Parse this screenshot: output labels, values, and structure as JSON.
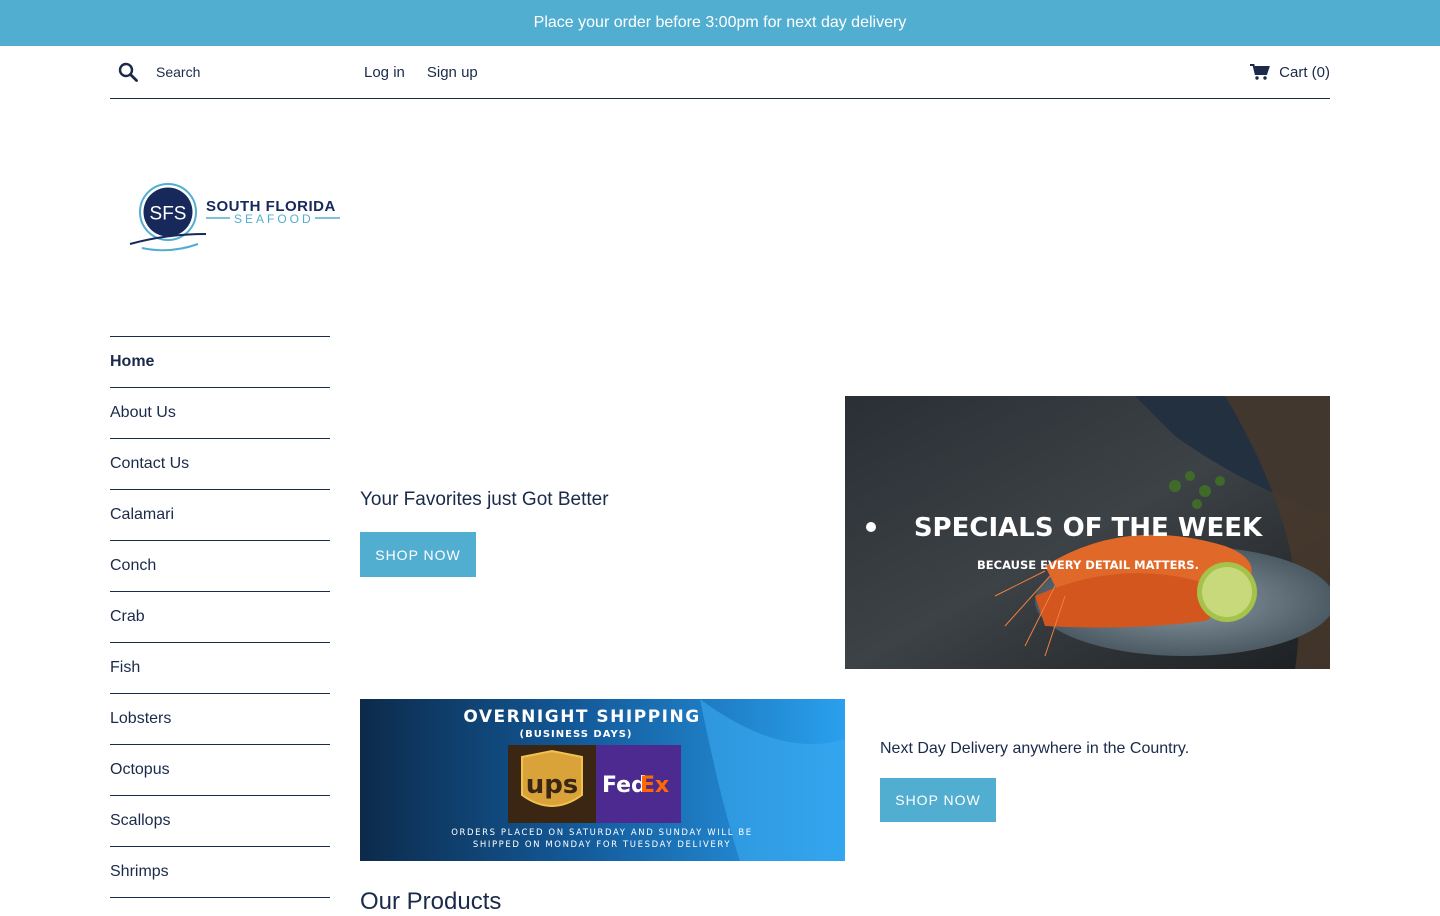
{
  "announcement": "Place your order before 3:00pm for next day delivery",
  "header": {
    "search_placeholder": "Search",
    "login": "Log in",
    "signup": "Sign up",
    "cart": "Cart (0)"
  },
  "logo": {
    "monogram": "SFS",
    "line1": "SOUTH FLORIDA",
    "line2": "SEAFOOD"
  },
  "nav": {
    "items": [
      {
        "label": "Home",
        "active": true
      },
      {
        "label": "About Us"
      },
      {
        "label": "Contact Us"
      },
      {
        "label": "Calamari"
      },
      {
        "label": "Conch"
      },
      {
        "label": "Crab"
      },
      {
        "label": "Fish"
      },
      {
        "label": "Lobsters"
      },
      {
        "label": "Octopus"
      },
      {
        "label": "Scallops"
      },
      {
        "label": "Shrimps"
      }
    ]
  },
  "promo1": {
    "text": "Your Favorites just Got Better",
    "button": "SHOP NOW",
    "banner_title": "SPECIALS OF THE WEEK",
    "banner_subtitle": "BECAUSE EVERY DETAIL MATTERS."
  },
  "promo2": {
    "text": "Next Day Delivery anywhere in the Country.",
    "button": "SHOP NOW",
    "banner_title": "OVERNIGHT SHIPPING",
    "banner_subtitle": "(BUSINESS DAYS)",
    "carrier1": "ups",
    "carrier2_a": "Fed",
    "carrier2_b": "Ex",
    "note_line1": "ORDERS PLACED ON SATURDAY AND SUNDAY WILL BE",
    "note_line2": "SHIPPED ON MONDAY FOR TUESDAY DELIVERY"
  },
  "section_heading": "Our Products",
  "colors": {
    "accent": "#52aed1",
    "text": "#1a2a4a"
  }
}
